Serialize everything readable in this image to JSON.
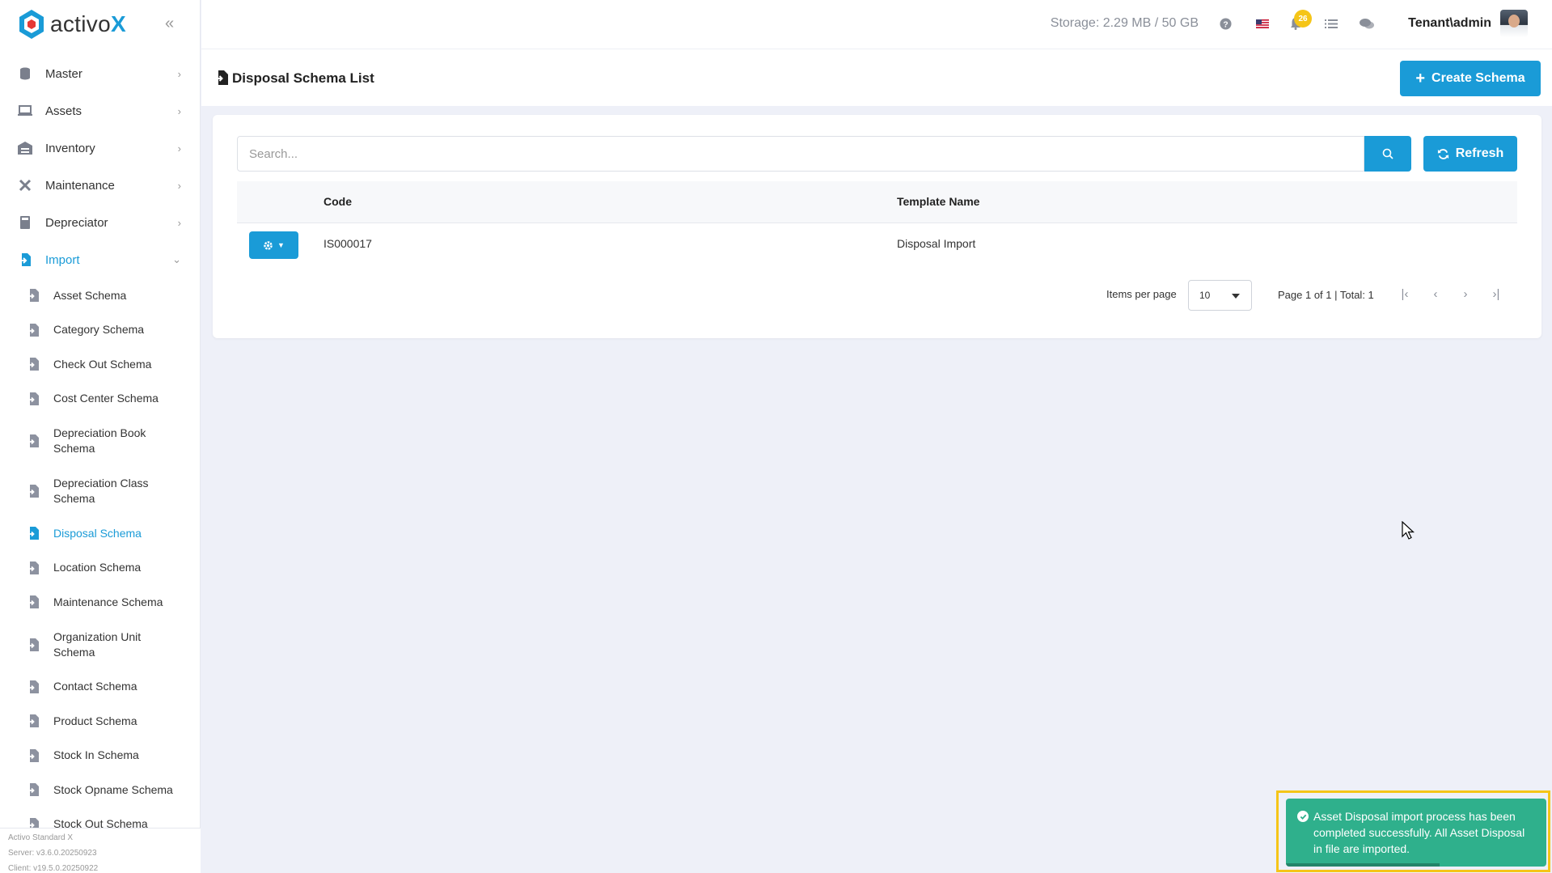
{
  "app": {
    "logo_text": "activo",
    "logo_x": "X",
    "accent": "#1a9bd7"
  },
  "topbar": {
    "storage": "Storage: 2.29 MB / 50 GB",
    "notification_count": "26",
    "user": "Tenant\\admin"
  },
  "nav": [
    {
      "label": "Master",
      "icon": "database-icon"
    },
    {
      "label": "Assets",
      "icon": "laptop-icon"
    },
    {
      "label": "Inventory",
      "icon": "warehouse-icon"
    },
    {
      "label": "Maintenance",
      "icon": "tools-icon"
    },
    {
      "label": "Depreciator",
      "icon": "calculator-icon"
    },
    {
      "label": "Import",
      "icon": "import-icon"
    }
  ],
  "import_sub": [
    "Asset Schema",
    "Category Schema",
    "Check Out Schema",
    "Cost Center Schema",
    "Depreciation Book Schema",
    "Depreciation Class Schema",
    "Disposal Schema",
    "Location Schema",
    "Maintenance Schema",
    "Organization Unit Schema",
    "Contact Schema",
    "Product Schema",
    "Stock In Schema",
    "Stock Opname Schema",
    "Stock Out Schema"
  ],
  "footer": {
    "product": "Activo Standard X",
    "server": "Server: v3.6.0.20250923",
    "client": "Client: v19.5.0.20250922"
  },
  "page": {
    "title": "Disposal Schema List",
    "create_label": "Create Schema",
    "search_placeholder": "Search...",
    "refresh_label": "Refresh"
  },
  "table": {
    "headers": {
      "code": "Code",
      "template_name": "Template Name"
    },
    "rows": [
      {
        "code": "IS000017",
        "template_name": "Disposal Import"
      }
    ]
  },
  "pagination": {
    "items_per_page_label": "Items per page",
    "items_per_page": "10",
    "info": "Page 1 of 1 | Total: 1"
  },
  "toast": {
    "message": "Asset Disposal import process has been completed successfully. All Asset Disposal in file are imported.",
    "color": "#2fb08c"
  }
}
